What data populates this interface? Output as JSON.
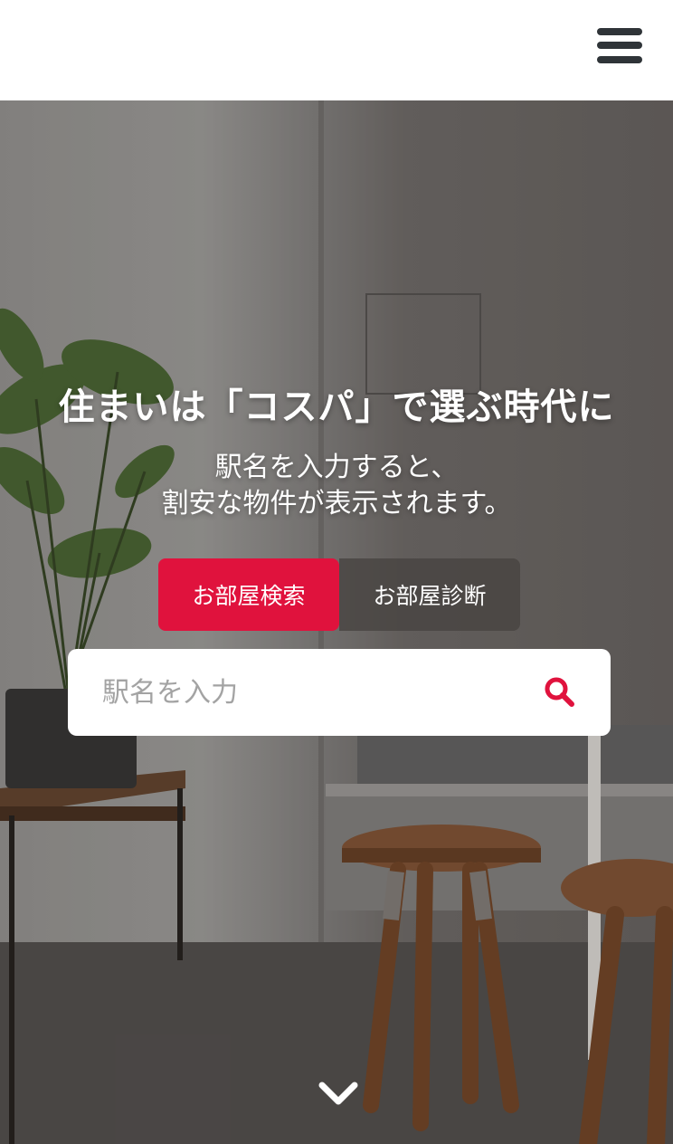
{
  "header": {
    "menu_icon": "hamburger-menu-icon"
  },
  "hero": {
    "headline": "住まいは「コスパ」で選ぶ時代に",
    "subline_1": "駅名を入力すると、",
    "subline_2": "割安な物件が表示されます。"
  },
  "tabs": [
    {
      "label": "お部屋検索",
      "active": true
    },
    {
      "label": "お部屋診断",
      "active": false
    }
  ],
  "search": {
    "placeholder": "駅名を入力",
    "value": "",
    "icon": "search-icon"
  },
  "scroll": {
    "icon": "chevron-down-icon"
  },
  "colors": {
    "accent": "#e0123d",
    "menu": "#2f3438",
    "tab_inactive": "#464240"
  }
}
